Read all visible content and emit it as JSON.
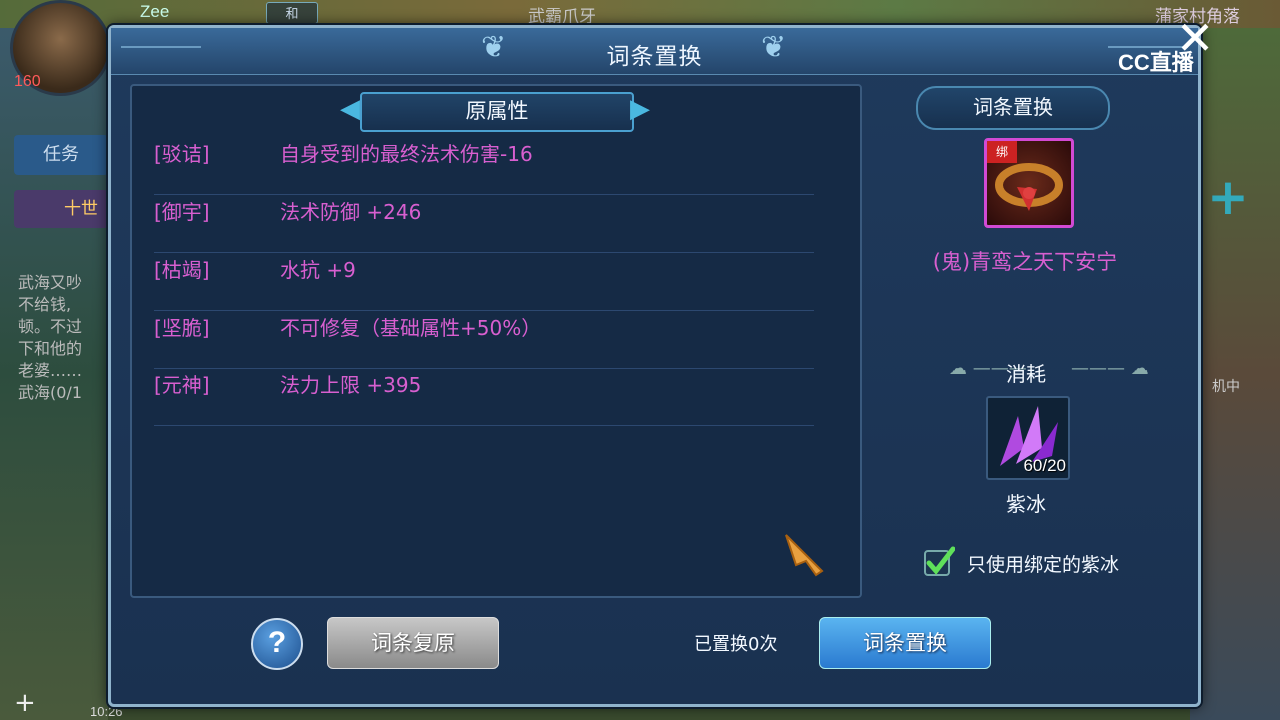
{
  "hud": {
    "player_name": "Zee",
    "hp": "160",
    "tag": "和",
    "center_text": "武霸爪牙",
    "location": "蒲家村角落",
    "task_button": "任务",
    "ten_label": "十世",
    "chat": "武海又吵\n不给钱,\n顿。不过\n下和他的\n老婆……\n武海(0/1",
    "right_text": "机中",
    "time": "10:26",
    "stream_logo": "CC直播"
  },
  "dialog": {
    "title": "词条置换",
    "original_section_label": "原属性",
    "attributes": [
      {
        "name": "[驳诘]",
        "value": "自身受到的最终法术伤害-16"
      },
      {
        "name": "[御宇]",
        "value": "法术防御 +246"
      },
      {
        "name": "[枯竭]",
        "value": "水抗 +9"
      },
      {
        "name": "[坚脆]",
        "value": "不可修复（基础属性+50%）"
      },
      {
        "name": "[元神]",
        "value": "法力上限 +395"
      }
    ],
    "right_section_label": "词条置换",
    "item": {
      "name": "(鬼)青鸾之天下安宁",
      "bind_badge": "绑"
    },
    "consume_label": "消耗",
    "material": {
      "name": "紫冰",
      "count": "60/20"
    },
    "checkbox_label": "只使用绑定的紫冰",
    "checkbox_checked": true,
    "help_label": "?",
    "restore_button": "词条复原",
    "replaced_count_text": "已置换0次",
    "replace_button": "词条置换"
  },
  "colors": {
    "attribute_text": "#d85fd0",
    "dialog_bg": "#1a3150",
    "accent_blue": "#4aa0d0"
  }
}
